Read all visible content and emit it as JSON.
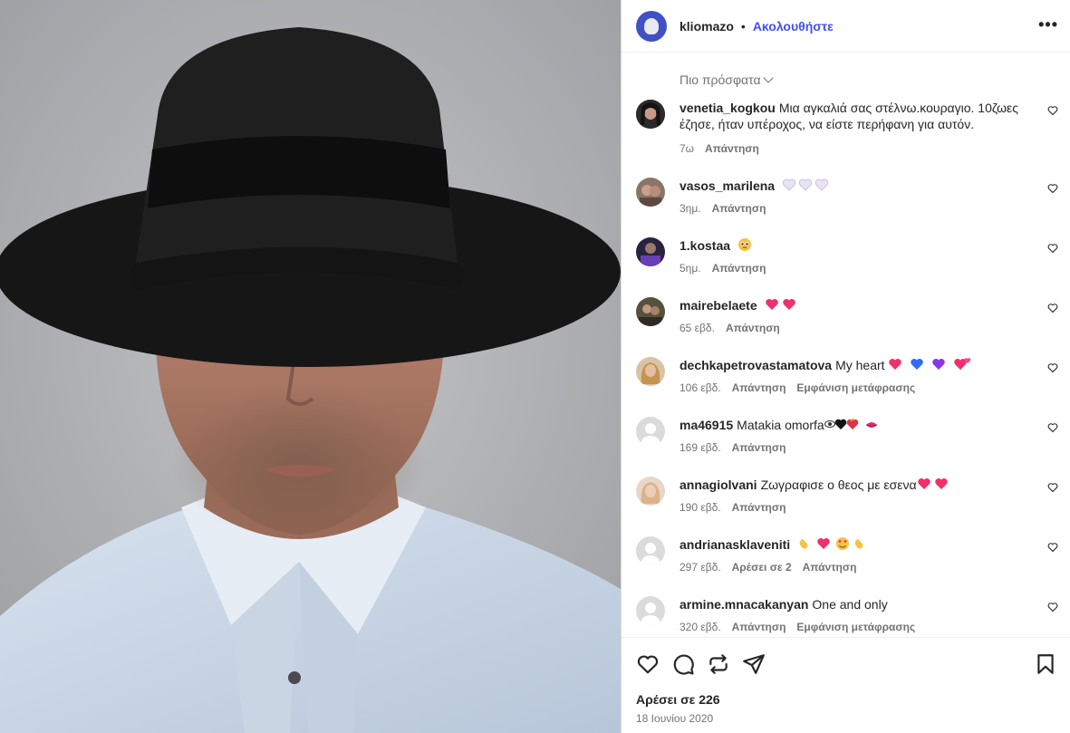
{
  "header": {
    "username": "kliomazo",
    "separator": "•",
    "follow_label": "Ακολουθήστε",
    "more_label": "•••"
  },
  "sort": {
    "label": "Πιο πρόσφατα"
  },
  "comments": [
    {
      "username": "venetia_kogkou",
      "text": "Μια αγκαλιά σας στέλνω.κουραγιο. 10ζωες έζησε, ήταν υπέροχος, να είστε περήφανη για αυτόν.",
      "time": "7ω",
      "reply": "Απάντηση"
    },
    {
      "username": "vasos_marilena",
      "text": "",
      "emojis": [
        "white-heart",
        "white-heart",
        "white-heart"
      ],
      "time": "3ημ.",
      "reply": "Απάντηση"
    },
    {
      "username": "1.kostaa",
      "text": "",
      "emojis": [
        "pleading-face"
      ],
      "time": "5ημ.",
      "reply": "Απάντηση"
    },
    {
      "username": "mairebelaete",
      "text": "",
      "emojis": [
        "sparkling-heart",
        "sparkling-heart"
      ],
      "time": "65 εβδ.",
      "reply": "Απάντηση"
    },
    {
      "username": "dechkapetrovastamatova",
      "text": "My heart",
      "emojis": [
        "sparkling-heart",
        "blue-heart",
        "purple-heart",
        "revolving-hearts"
      ],
      "time": "106 εβδ.",
      "reply": "Απάντηση",
      "translate": "Εμφάνιση μετάφρασης"
    },
    {
      "username": "ma46915",
      "text": "Matakia omorfa",
      "emojis": [
        "eye",
        "black-heart",
        "heart-on-fire",
        "kiss-mark"
      ],
      "time": "169 εβδ.",
      "reply": "Απάντηση"
    },
    {
      "username": "annagiolvani",
      "text": "Ζωγραφισε ο θεος με εσενα",
      "emojis": [
        "sparkling-heart",
        "sparkling-heart"
      ],
      "time": "190 εβδ.",
      "reply": "Απάντηση"
    },
    {
      "username": "andrianasklaveniti",
      "text": "",
      "emojis": [
        "clapping-hands",
        "sparkling-heart",
        "heart-eyes",
        "clapping-hands"
      ],
      "time": "297 εβδ.",
      "likes": "Αρέσει σε 2",
      "reply": "Απάντηση"
    },
    {
      "username": "armine.mnacakanyan",
      "text": "One and only",
      "time": "320 εβδ.",
      "reply": "Απάντηση",
      "translate": "Εμφάνιση μετάφρασης"
    }
  ],
  "footer": {
    "likes": "Αρέσει σε 226",
    "date": "18 Ιουνίου 2020"
  },
  "colors": {
    "accent": "#4150f7",
    "text": "#262626",
    "muted": "#737373",
    "emoji_pink": "#f0306b",
    "emoji_blue": "#2f6bff",
    "emoji_purple": "#8c35e8"
  }
}
